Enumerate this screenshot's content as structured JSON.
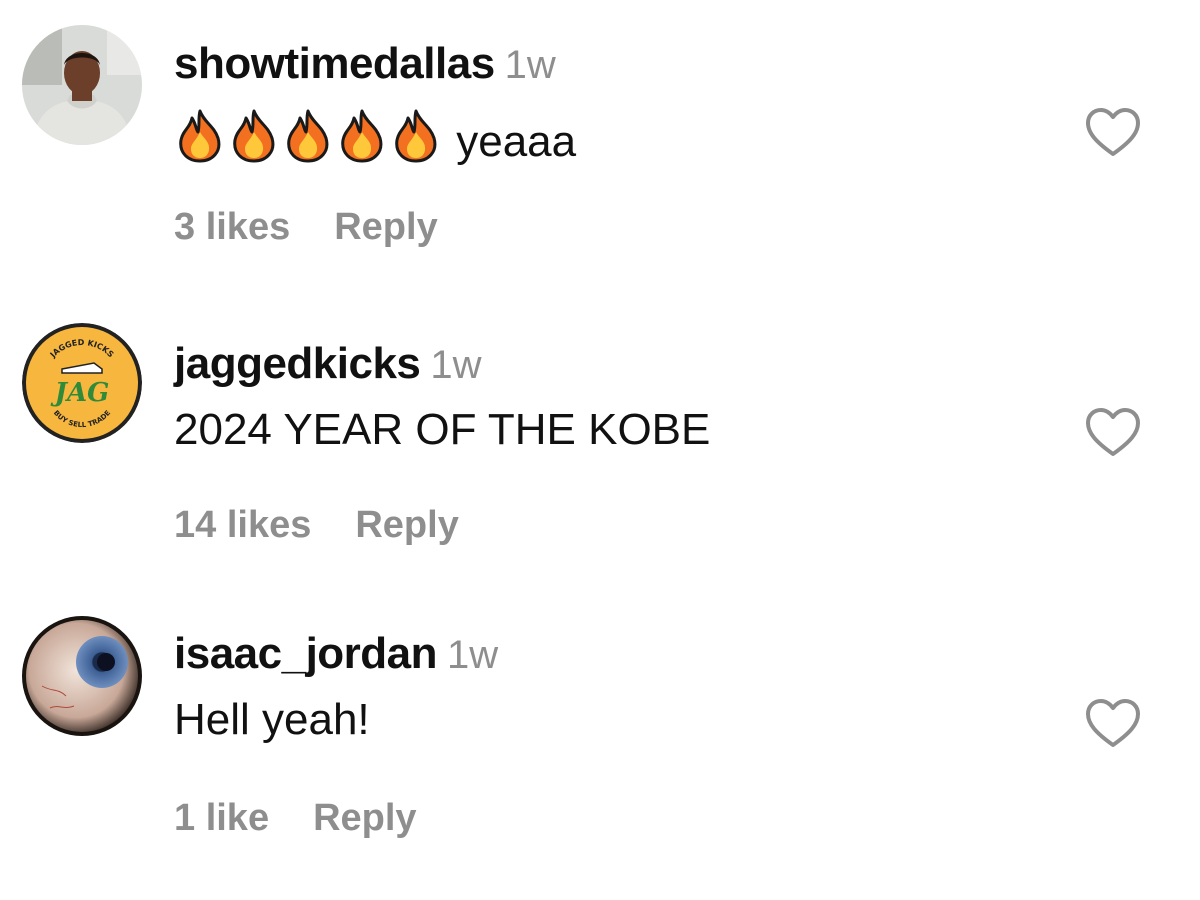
{
  "comments": [
    {
      "username": "showtimedallas",
      "time": "1w",
      "emoji_count": 5,
      "text": "yeaaa",
      "likes": "3 likes",
      "reply_label": "Reply"
    },
    {
      "username": "jaggedkicks",
      "time": "1w",
      "text": "2024 YEAR OF THE KOBE",
      "likes": "14 likes",
      "reply_label": "Reply",
      "avatar_logo_text": "JAG",
      "avatar_logo_top": "JAGGED KICKS",
      "avatar_logo_bottom": "BUY SELL TRADE"
    },
    {
      "username": "isaac_jordan",
      "time": "1w",
      "text": "Hell yeah!",
      "likes": "1 like",
      "reply_label": "Reply"
    }
  ],
  "icons": {
    "heart": "heart-outline-icon",
    "fire": "fire-emoji-icon"
  },
  "colors": {
    "muted": "#8e8e8e",
    "text": "#111111",
    "logo_bg": "#f7b63d",
    "logo_green": "#2f8a3a"
  }
}
